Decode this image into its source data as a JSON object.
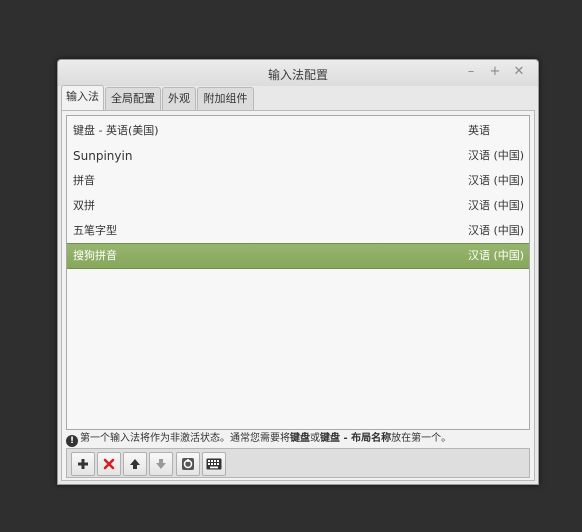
{
  "window": {
    "title": "输入法配置"
  },
  "window_controls": {
    "minimize": "–",
    "maximize": "+",
    "close": "✕"
  },
  "tabs": [
    {
      "label": "输入法",
      "active": true
    },
    {
      "label": "全局配置",
      "active": false
    },
    {
      "label": "外观",
      "active": false
    },
    {
      "label": "附加组件",
      "active": false
    }
  ],
  "input_methods": [
    {
      "name": "键盘 - 英语(美国)",
      "language": "英语",
      "selected": false
    },
    {
      "name": "Sunpinyin",
      "language": "汉语 (中国)",
      "selected": false
    },
    {
      "name": "拼音",
      "language": "汉语 (中国)",
      "selected": false
    },
    {
      "name": "双拼",
      "language": "汉语 (中国)",
      "selected": false
    },
    {
      "name": "五笔字型",
      "language": "汉语 (中国)",
      "selected": false
    },
    {
      "name": "搜狗拼音",
      "language": "汉语 (中国)",
      "selected": true
    }
  ],
  "note": {
    "part1": "第一个输入法将作为非激活状态。通常您需要将",
    "bold1": "键盘",
    "part2": "或",
    "bold2": "键盘 - 布局名称",
    "part3": "放在第一个。"
  },
  "toolbar": {
    "icons": [
      "plus-icon",
      "delete-icon",
      "arrow-up-icon",
      "arrow-down-icon",
      "configure-icon",
      "keyboard-icon"
    ]
  },
  "colors": {
    "selection": "#8aab61",
    "background": "#2f2f2f"
  }
}
